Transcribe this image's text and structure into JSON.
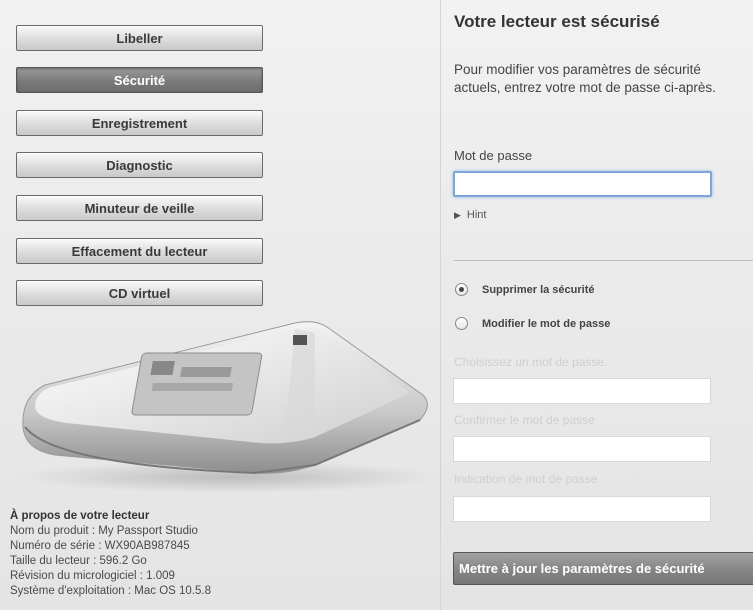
{
  "nav": {
    "items": [
      {
        "label": "Libeller"
      },
      {
        "label": "Sécurité"
      },
      {
        "label": "Enregistrement"
      },
      {
        "label": "Diagnostic"
      },
      {
        "label": "Minuteur de veille"
      },
      {
        "label": "Effacement du lecteur"
      },
      {
        "label": "CD virtuel"
      }
    ],
    "active_index": 1
  },
  "about": {
    "heading": "À propos de votre lecteur",
    "lines": [
      "Nom du produit : My Passport Studio",
      "Numéro de série : WX90AB987845",
      "Taille du lecteur : 596.2 Go",
      "Révision du micrologiciel : 1.009",
      "Système d'exploitation : Mac OS 10.5.8"
    ]
  },
  "security": {
    "title": "Votre lecteur est sécurisé",
    "description_line1": "Pour modifier vos paramètres de sécurité",
    "description_line2": "actuels, entrez votre mot de passe ci-après.",
    "password_label": "Mot de passe",
    "password_value": "",
    "hint_label": "Hint",
    "options": [
      {
        "label": "Supprimer la sécurité",
        "selected": true
      },
      {
        "label": "Modifier le mot de passe",
        "selected": false
      }
    ],
    "fields": [
      {
        "label": "Choisissez un mot de passe.",
        "value": ""
      },
      {
        "label": "Confirmer le mot de passe",
        "value": ""
      },
      {
        "label": "Indication de mot de passe",
        "value": ""
      }
    ],
    "update_button": "Mettre à jour les paramètres de sécurité"
  },
  "colors": {
    "active_button": "#7b7b7b",
    "focus_ring": "#7ea6d9",
    "disabled_label": "#cfcfcf"
  }
}
